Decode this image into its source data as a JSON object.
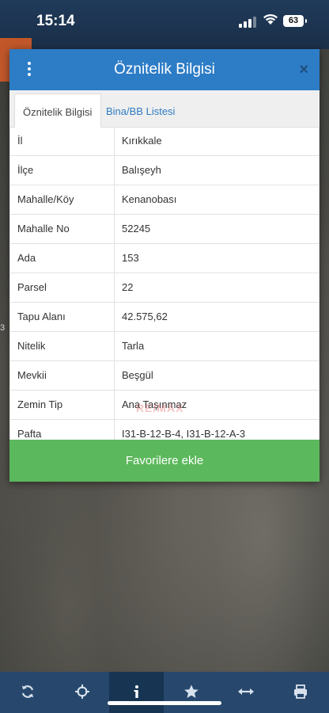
{
  "status_bar": {
    "time": "15:14",
    "battery": "63"
  },
  "map": {
    "edge_label": "3"
  },
  "dialog": {
    "title": "Öznitelik Bilgisi",
    "close_label": "×",
    "tabs": [
      {
        "label": "Öznitelik Bilgisi",
        "active": true
      },
      {
        "label": "Bina/BB Listesi",
        "active": false
      }
    ],
    "rows": [
      {
        "key": "İl",
        "value": "Kırıkkale"
      },
      {
        "key": "İlçe",
        "value": "Balışeyh"
      },
      {
        "key": "Mahalle/Köy",
        "value": "Kenanobası"
      },
      {
        "key": "Mahalle No",
        "value": "52245"
      },
      {
        "key": "Ada",
        "value": "153"
      },
      {
        "key": "Parsel",
        "value": "22"
      },
      {
        "key": "Tapu Alanı",
        "value": "42.575,62"
      },
      {
        "key": "Nitelik",
        "value": "Tarla"
      },
      {
        "key": "Mevkii",
        "value": "Beşgül"
      },
      {
        "key": "Zemin Tip",
        "value": "Ana Taşınmaz"
      },
      {
        "key": "Pafta",
        "value": "I31-B-12-B-4, I31-B-12-A-3"
      }
    ],
    "favorite_button": "Favorilere ekle",
    "watermark": "RE/MAX"
  },
  "toolbar": {
    "icons": [
      "refresh-icon",
      "crosshair-icon",
      "info-icon",
      "star-icon",
      "measure-icon",
      "print-icon"
    ],
    "active_index": 2
  },
  "colors": {
    "header_blue": "#2d7cc6",
    "toolbar_blue": "#27486c",
    "button_green": "#5cb85c"
  }
}
